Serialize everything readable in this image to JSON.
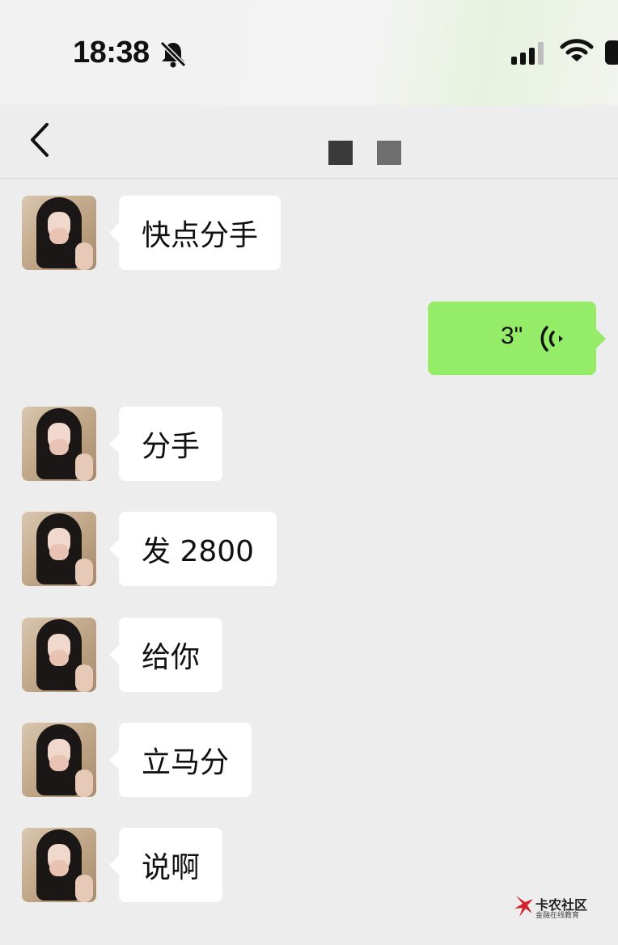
{
  "status_bar": {
    "time": "18:38",
    "mute_icon": "bell-slash-icon",
    "signal_icon": "signal-bars-icon",
    "wifi_icon": "wifi-icon",
    "battery_icon": "battery-icon"
  },
  "nav": {
    "back_icon": "chevron-left-icon",
    "title": ""
  },
  "colors": {
    "background": "#ededed",
    "incoming_bubble": "#ffffff",
    "outgoing_bubble": "#95ec69"
  },
  "messages": [
    {
      "side": "left",
      "type": "text",
      "text": "快点分手"
    },
    {
      "side": "right",
      "type": "voice",
      "duration": "3\""
    },
    {
      "side": "left",
      "type": "text",
      "text": "分手"
    },
    {
      "side": "left",
      "type": "text",
      "text": "发 2800"
    },
    {
      "side": "left",
      "type": "text",
      "text": "给你"
    },
    {
      "side": "left",
      "type": "text",
      "text": "立马分"
    },
    {
      "side": "left",
      "type": "text",
      "text": "说啊"
    }
  ],
  "watermark": {
    "title": "卡农社区",
    "subtitle": "金融在线教育"
  }
}
